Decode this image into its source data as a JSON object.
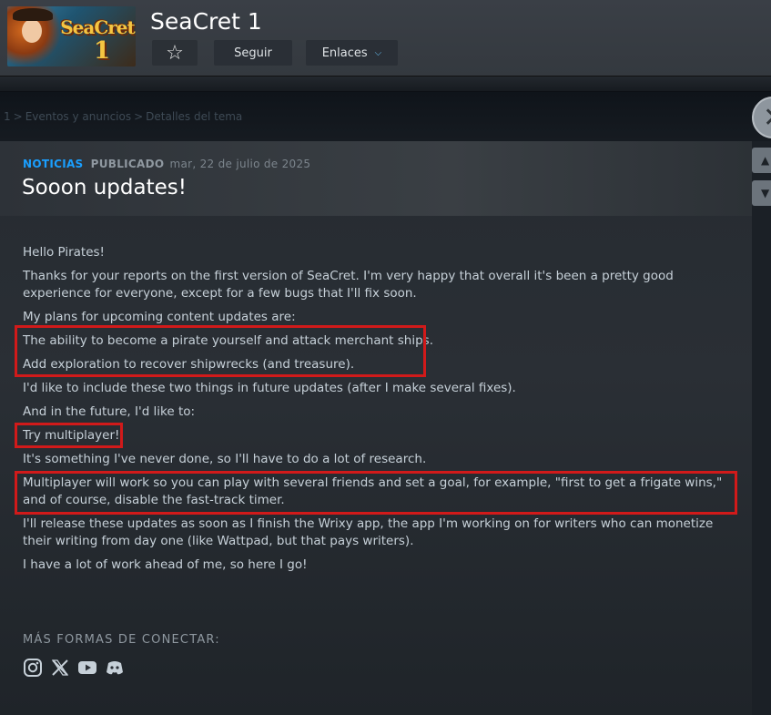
{
  "app": {
    "title": "SeaCret 1",
    "capsule_logo_line1": "SeaCret",
    "capsule_logo_line2": "1"
  },
  "header": {
    "favorite_icon": "star-outline-icon",
    "follow_label": "Seguir",
    "links_label": "Enlaces",
    "links_chevron": "chevron-down-icon"
  },
  "breadcrumb": {
    "items": [
      "1",
      "Eventos y anuncios",
      "Detalles del tema"
    ],
    "separator": ">"
  },
  "nav": {
    "close_icon": "close-icon",
    "prev_icon": "chevron-up-icon",
    "next_icon": "chevron-down-icon"
  },
  "post": {
    "tag": "NOTICIAS",
    "published_label": "PUBLICADO",
    "date": "mar, 22 de julio de 2025",
    "title": "Sooon updates!",
    "paragraphs": [
      "Hello Pirates!",
      "Thanks for your reports on the first version of SeaCret. I'm very happy that overall it's been a pretty good experience for everyone, except for a few bugs that I'll fix soon.",
      "My plans for upcoming content updates are:",
      "The ability to become a pirate yourself and attack merchant ships.",
      "Add exploration to recover shipwrecks (and treasure).",
      "I'd like to include these two things in future updates (after I make several fixes).",
      "And in the future, I'd like to:",
      "Try multiplayer!",
      "It's something I've never done, so I'll have to do a lot of research.",
      "Multiplayer will work so you can play with several friends and set a goal, for example, \"first to get a frigate wins,\" and of course, disable the fast-track timer.",
      "I'll release these updates as soon as I finish the Wrixy app, the app I'm working on for writers who can monetize their writing from day one (like Wattpad, but that pays writers).",
      "I have a lot of work ahead of me, so here I go!"
    ],
    "connect_label": "MÁS FORMAS DE CONECTAR:",
    "socials": [
      "instagram-icon",
      "x-icon",
      "youtube-icon",
      "discord-icon"
    ]
  },
  "colors": {
    "accent": "#1a9fff",
    "highlight_box": "#d11a1a",
    "header_bg": "#3a3f46",
    "page_bg": "#1b2026"
  }
}
